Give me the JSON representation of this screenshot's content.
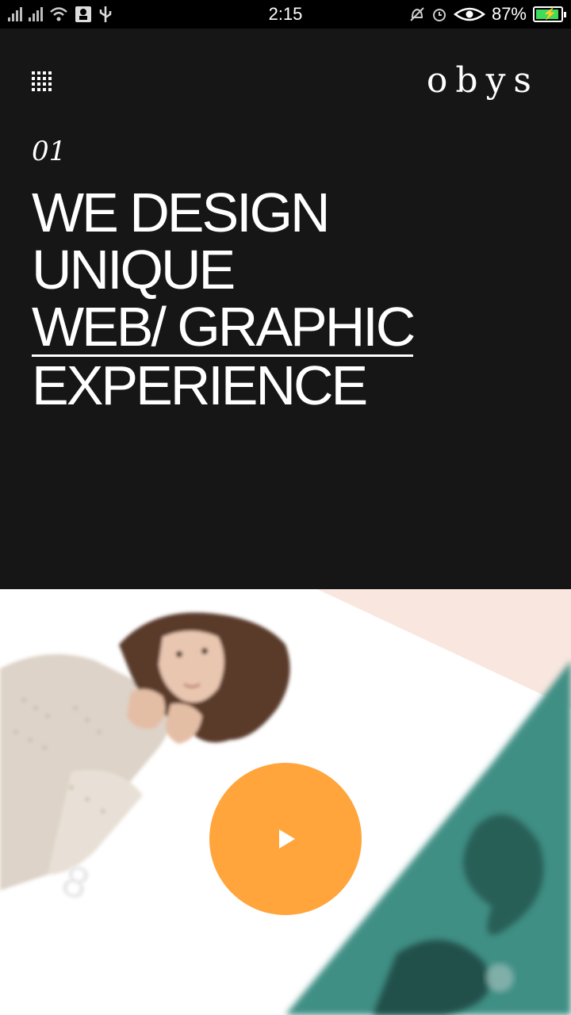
{
  "status_bar": {
    "time": "2:15",
    "battery_percent": "87%",
    "battery_level": 0.87,
    "left_icons": [
      "signal-icon",
      "wifi-icon",
      "notification-icon",
      "usb-icon"
    ],
    "right_icons": [
      "mute-icon",
      "alarm-icon",
      "eye-icon",
      "battery-icon"
    ]
  },
  "header": {
    "logo": "obys",
    "menu_icon": "grid-menu-icon"
  },
  "hero": {
    "index": "01",
    "headline": {
      "line1": "WE DESIGN",
      "line2": "UNIQUE",
      "line3": "WEB/ GRAPHIC",
      "line4": "EXPERIENCE"
    }
  },
  "video": {
    "play_icon": "play-icon",
    "accent_color": "#ffa53b"
  },
  "colors": {
    "background": "#161616",
    "text": "#ffffff",
    "accent": "#ffa53b",
    "teal": "#3f8f85"
  }
}
